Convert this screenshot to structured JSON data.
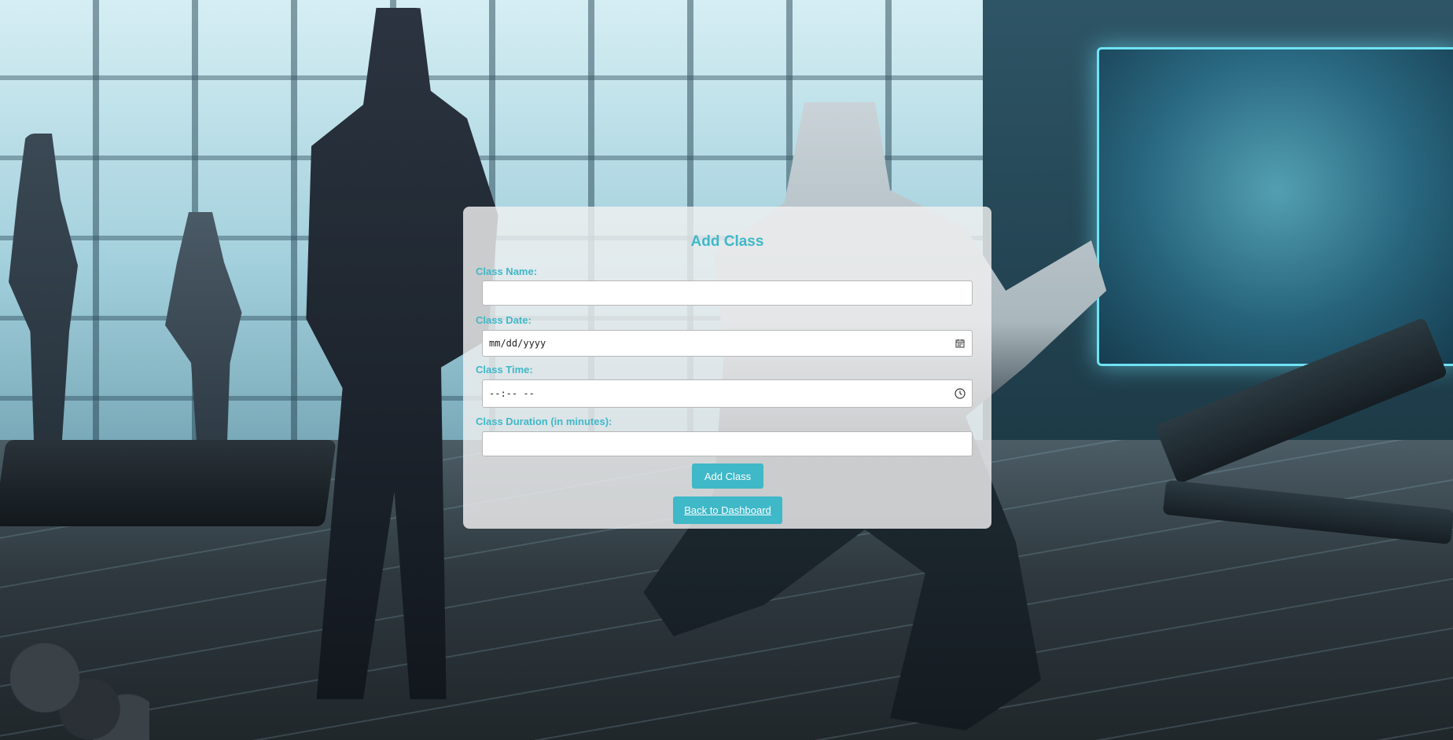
{
  "form": {
    "title": "Add Class",
    "fields": {
      "class_name": {
        "label": "Class Name:",
        "value": ""
      },
      "class_date": {
        "label": "Class Date:",
        "placeholder": "mm/dd/yyyy"
      },
      "class_time": {
        "label": "Class Time:",
        "placeholder": "--:-- --"
      },
      "class_duration": {
        "label": "Class Duration (in minutes):",
        "value": ""
      }
    },
    "submit_label": "Add Class",
    "back_link_label": "Back to Dashboard"
  },
  "icons": {
    "date": "calendar-icon",
    "time": "clock-icon"
  },
  "colors": {
    "accent": "#3fb8c8",
    "card_background": "#f0f0f0"
  }
}
